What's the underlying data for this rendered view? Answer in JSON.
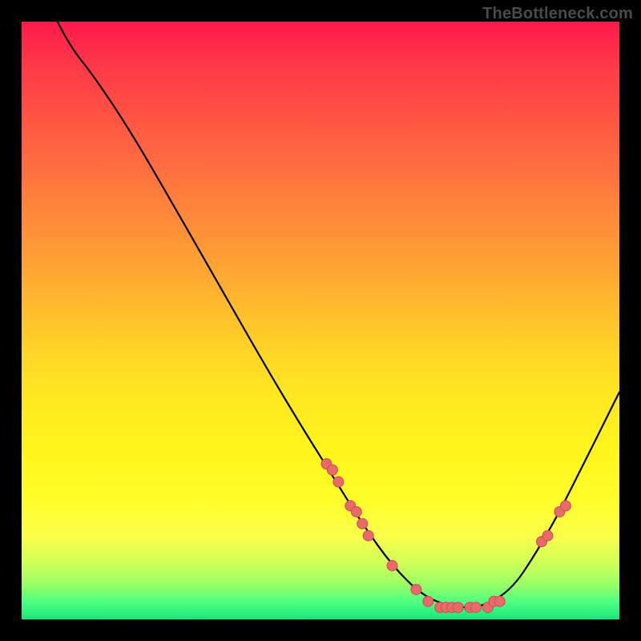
{
  "watermark": "TheBottleneck.com",
  "colors": {
    "dot_fill": "#e86a6a",
    "dot_stroke": "#c94f4f",
    "curve": "#000000"
  },
  "chart_data": {
    "type": "line",
    "title": "",
    "xlabel": "",
    "ylabel": "",
    "xlim": [
      0,
      100
    ],
    "ylim": [
      0,
      100
    ],
    "curve": [
      {
        "x": 6,
        "y": 100
      },
      {
        "x": 8,
        "y": 96
      },
      {
        "x": 12,
        "y": 91
      },
      {
        "x": 18,
        "y": 82
      },
      {
        "x": 25,
        "y": 70
      },
      {
        "x": 33,
        "y": 56
      },
      {
        "x": 41,
        "y": 42
      },
      {
        "x": 47,
        "y": 32
      },
      {
        "x": 52,
        "y": 24
      },
      {
        "x": 57,
        "y": 16
      },
      {
        "x": 62,
        "y": 9
      },
      {
        "x": 67,
        "y": 4
      },
      {
        "x": 72,
        "y": 2
      },
      {
        "x": 77,
        "y": 2
      },
      {
        "x": 82,
        "y": 5
      },
      {
        "x": 86,
        "y": 11
      },
      {
        "x": 90,
        "y": 18
      },
      {
        "x": 94,
        "y": 26
      },
      {
        "x": 98,
        "y": 34
      },
      {
        "x": 100,
        "y": 38
      }
    ],
    "points": [
      {
        "x": 51,
        "y": 26
      },
      {
        "x": 52,
        "y": 25
      },
      {
        "x": 53,
        "y": 23
      },
      {
        "x": 55,
        "y": 19
      },
      {
        "x": 56,
        "y": 18
      },
      {
        "x": 57,
        "y": 16
      },
      {
        "x": 58,
        "y": 14
      },
      {
        "x": 62,
        "y": 9
      },
      {
        "x": 66,
        "y": 5
      },
      {
        "x": 68,
        "y": 3
      },
      {
        "x": 70,
        "y": 2
      },
      {
        "x": 71,
        "y": 2
      },
      {
        "x": 72,
        "y": 2
      },
      {
        "x": 73,
        "y": 2
      },
      {
        "x": 75,
        "y": 2
      },
      {
        "x": 76,
        "y": 2
      },
      {
        "x": 78,
        "y": 2
      },
      {
        "x": 79,
        "y": 3
      },
      {
        "x": 80,
        "y": 3
      },
      {
        "x": 87,
        "y": 13
      },
      {
        "x": 88,
        "y": 14
      },
      {
        "x": 90,
        "y": 18
      },
      {
        "x": 91,
        "y": 19
      }
    ]
  }
}
